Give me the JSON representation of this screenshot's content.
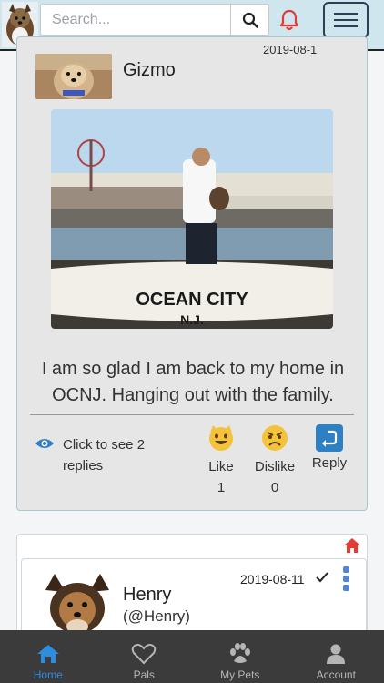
{
  "search": {
    "placeholder": "Search..."
  },
  "post": {
    "author": "Gizmo",
    "date": "2019-08-1",
    "text": "I am so glad I am back to my home in OCNJ. Hanging out with the family.",
    "photo_sign": "OCEAN CITY",
    "photo_sign2": "N.J.",
    "replies_label": "Click to see 2 replies",
    "reactions": [
      {
        "label": "Like",
        "count": "1"
      },
      {
        "label": "Dislike",
        "count": "0"
      },
      {
        "label": "Reply"
      }
    ]
  },
  "post2": {
    "author": "Henry",
    "handle": "(@Henry)",
    "date": "2019-08-11"
  },
  "nav": [
    {
      "label": "Home",
      "icon": "home-icon",
      "active": true
    },
    {
      "label": "Pals",
      "icon": "heart-icon"
    },
    {
      "label": "My Pets",
      "icon": "paw-icon"
    },
    {
      "label": "Account",
      "icon": "user-icon"
    }
  ],
  "colors": {
    "accent": "#2f8de0",
    "bell": "#e53935",
    "topbar": "#cfe6ee",
    "nav_bg": "#3b3b3b"
  }
}
